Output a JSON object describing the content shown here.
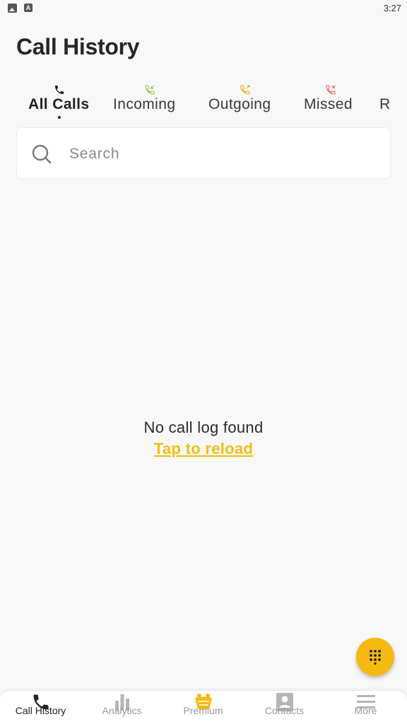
{
  "status_bar": {
    "time": "3:27",
    "notification_letter": "A"
  },
  "header": {
    "title": "Call History"
  },
  "tabs": [
    {
      "label": "All Calls",
      "icon": "phone-icon",
      "active": true
    },
    {
      "label": "Incoming",
      "icon": "incoming-call-icon",
      "color": "#8dc63f"
    },
    {
      "label": "Outgoing",
      "icon": "outgoing-call-icon",
      "color": "#f3a51a"
    },
    {
      "label": "Missed",
      "icon": "missed-call-icon",
      "color": "#e85a5a"
    },
    {
      "label": "R"
    }
  ],
  "search": {
    "placeholder": "Search",
    "value": ""
  },
  "empty_state": {
    "message": "No call log found",
    "action": "Tap to reload"
  },
  "fab": {
    "icon": "dialpad-icon",
    "color": "#f6b90f"
  },
  "bottom_nav": [
    {
      "label": "Call History",
      "icon": "phone-icon",
      "active": true
    },
    {
      "label": "Analytics",
      "icon": "bar-chart-icon"
    },
    {
      "label": "Premium",
      "icon": "crown-icon"
    },
    {
      "label": "Contacts",
      "icon": "contact-card-icon"
    },
    {
      "label": "More",
      "icon": "menu-icon"
    }
  ],
  "colors": {
    "accent": "#f3bd12",
    "background": "#f8f8f8",
    "text_dark": "#25252d"
  }
}
